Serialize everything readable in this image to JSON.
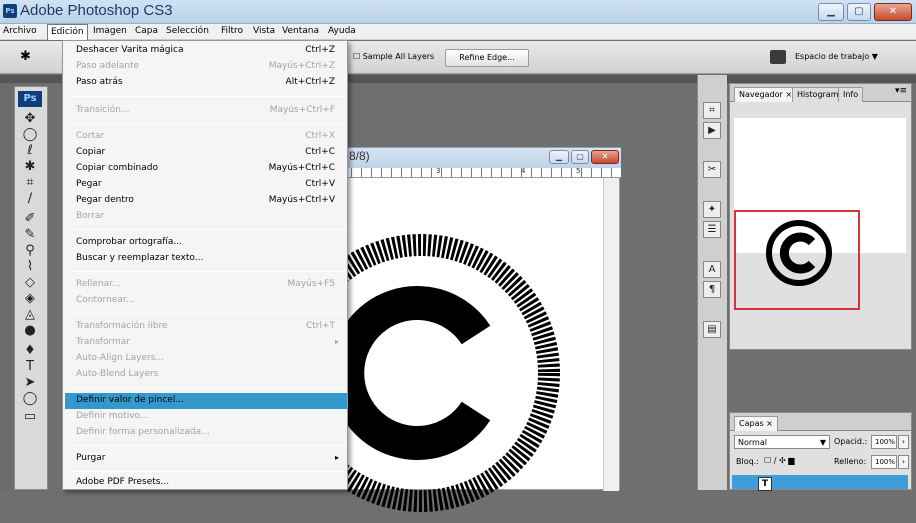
{
  "window": {
    "title": "Adobe Photoshop CS3",
    "logo": "Ps"
  },
  "menubar": [
    "Archivo",
    "Edición",
    "Imagen",
    "Capa",
    "Selección",
    "Filtro",
    "Vista",
    "Ventana",
    "Ayuda"
  ],
  "options": {
    "sample_all_layers": "Sample All Layers",
    "refine_edge": "Refine Edge...",
    "workspace": "Espacio de trabajo ▼"
  },
  "menu": {
    "items": [
      {
        "label": "Deshacer Varita mágica",
        "shortcut": "Ctrl+Z",
        "enabled": true
      },
      {
        "label": "Paso adelante",
        "shortcut": "Mayús+Ctrl+Z",
        "enabled": false
      },
      {
        "label": "Paso atrás",
        "shortcut": "Alt+Ctrl+Z",
        "enabled": true
      },
      {
        "label": "Transición...",
        "shortcut": "Mayús+Ctrl+F",
        "enabled": false
      },
      {
        "label": "Cortar",
        "shortcut": "Ctrl+X",
        "enabled": false
      },
      {
        "label": "Copiar",
        "shortcut": "Ctrl+C",
        "enabled": true
      },
      {
        "label": "Copiar combinado",
        "shortcut": "Mayús+Ctrl+C",
        "enabled": true
      },
      {
        "label": "Pegar",
        "shortcut": "Ctrl+V",
        "enabled": true
      },
      {
        "label": "Pegar dentro",
        "shortcut": "Mayús+Ctrl+V",
        "enabled": true
      },
      {
        "label": "Borrar",
        "shortcut": "",
        "enabled": false
      },
      {
        "label": "Comprobar ortografía...",
        "shortcut": "",
        "enabled": true
      },
      {
        "label": "Buscar y reemplazar texto...",
        "shortcut": "",
        "enabled": true
      },
      {
        "label": "Rellenar...",
        "shortcut": "Mayús+F5",
        "enabled": false
      },
      {
        "label": "Contornear...",
        "shortcut": "",
        "enabled": false
      },
      {
        "label": "Transformación libre",
        "shortcut": "Ctrl+T",
        "enabled": false
      },
      {
        "label": "Transformar",
        "shortcut": "",
        "enabled": false
      },
      {
        "label": "Auto-Align Layers...",
        "shortcut": "",
        "enabled": false
      },
      {
        "label": "Auto-Blend Layers",
        "shortcut": "",
        "enabled": false
      },
      {
        "label": "Definir valor de pincel...",
        "shortcut": "",
        "enabled": true
      },
      {
        "label": "Definir motivo...",
        "shortcut": "",
        "enabled": false
      },
      {
        "label": "Definir forma personalizada...",
        "shortcut": "",
        "enabled": false
      },
      {
        "label": "Purgar",
        "shortcut": "",
        "enabled": true
      },
      {
        "label": "Adobe PDF Presets...",
        "shortcut": "",
        "enabled": true
      }
    ]
  },
  "document": {
    "title_fragment": "8/8)",
    "ruler": [
      "2",
      "3",
      "4",
      "5"
    ]
  },
  "navigator": {
    "tabs": [
      "Navegador ×",
      "Histograma",
      "Info"
    ]
  },
  "layers": {
    "tab": "Capas ×",
    "blend": "Normal",
    "opacity_label": "Opacid.:",
    "opacity": "100%",
    "lock_label": "Bloq.:",
    "fill_label": "Relleno:",
    "fill": "100%"
  },
  "colors": {
    "highlight": "#3399cc",
    "navigator_frame": "#d6323a"
  }
}
